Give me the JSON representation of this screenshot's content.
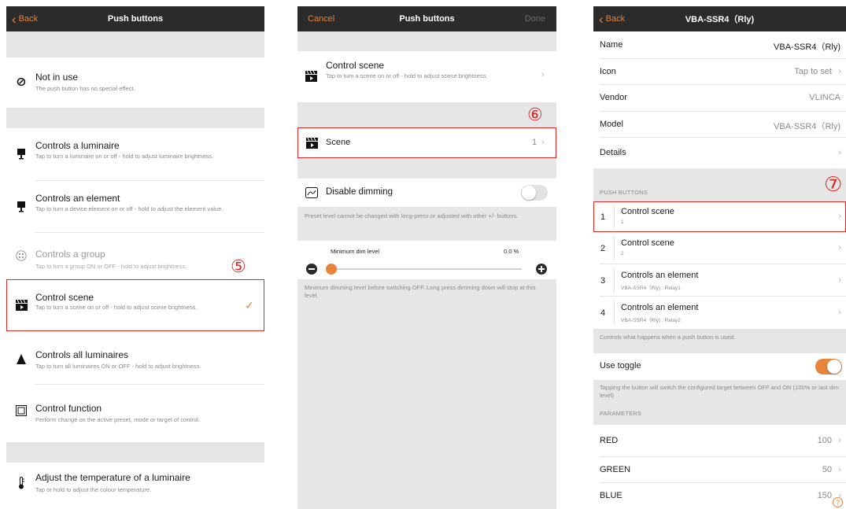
{
  "screen1": {
    "back_label": "Back",
    "title": "Push buttons",
    "items": [
      {
        "title": "Not in use",
        "subtitle": "The push button has no special effect."
      },
      {
        "title": "Controls a luminaire",
        "subtitle": "Tap to turn a luminaire on or off - hold to adjust luminaire brightness."
      },
      {
        "title": "Controls an element",
        "subtitle": "Tap to turn a device element on or off - hold to adjust the element value."
      },
      {
        "title": "Controls a group",
        "subtitle": "Tap to turn a group ON or OFF - hold to adjust brightness."
      },
      {
        "title": "Control scene",
        "subtitle": "Tap to turn a scene on or off - hold to adjust scene brightness."
      },
      {
        "title": "Controls all luminaires",
        "subtitle": "Tap to turn all luminaires ON or OFF - hold to adjust brightness."
      },
      {
        "title": "Control function",
        "subtitle": "Perform change on the active preset, mode or target of control."
      },
      {
        "title": "Adjust the temperature of a luminaire",
        "subtitle": "Tap or hold to adjust the colour temperature."
      }
    ],
    "annotation": "⑤",
    "check_mark": "✓"
  },
  "screen2": {
    "cancel_label": "Cancel",
    "title": "Push buttons",
    "done_label": "Done",
    "control_scene": {
      "title": "Control scene",
      "subtitle": "Tap to turn a scene on or off - hold to adjust scene brightness."
    },
    "annotation": "⑥",
    "scene": {
      "label": "Scene",
      "value": "1"
    },
    "disable_dimming": {
      "label": "Disable dimming",
      "toggle_on": false
    },
    "disable_note": "Preset level cannot be changed with long-press or adjusted with other +/- buttons.",
    "min_dim": {
      "label": "Minimum dim level",
      "value": "0.0 %",
      "slider_fraction": 0.0
    },
    "min_dim_note": "Minimum dimming level before switching OFF. Long press dimming down will stop at this level."
  },
  "screen3": {
    "back_label": "Back",
    "title": "VBA-SSR4（Rly)",
    "props": [
      {
        "label": "Name",
        "value": "VBA-SSR4（Rly)",
        "chevron": false
      },
      {
        "label": "Icon",
        "value": "Tap to set",
        "chevron": true
      },
      {
        "label": "Vendor",
        "value": "VLINCA",
        "chevron": false
      },
      {
        "label": "Model",
        "value": "VBA-SSR4（Rly)",
        "chevron": false
      },
      {
        "label": "Details",
        "value": "",
        "chevron": true
      }
    ],
    "push_buttons_header": "PUSH BUTTONS",
    "annotation": "⑦",
    "push_buttons": [
      {
        "num": "1",
        "title": "Control scene",
        "sub": "1"
      },
      {
        "num": "2",
        "title": "Control scene",
        "sub": "2"
      },
      {
        "num": "3",
        "title": "Controls an element",
        "sub": "VBA-SSR4（Rly) : Relay1"
      },
      {
        "num": "4",
        "title": "Controls an element",
        "sub": "VBA-SSR4（Rly) : Relay2"
      }
    ],
    "push_note": "Controls what happens when a push button is used.",
    "use_toggle": {
      "label": "Use toggle",
      "toggle_on": true
    },
    "toggle_note": "Tapping the button will switch the configured target between OFF and ON (100% or last dim level)",
    "parameters_header": "PARAMETERS",
    "parameters": [
      {
        "label": "RED",
        "value": "100"
      },
      {
        "label": "GREEN",
        "value": "50"
      },
      {
        "label": "BLUE",
        "value": "150"
      }
    ],
    "help_glyph": "?"
  },
  "colors": {
    "accent": "#e8833a",
    "navbar": "#2b2b2b",
    "annotation_red": "#d92a2a",
    "group_bg": "#e6e6e6"
  },
  "glyphs": {
    "chevron_right": "›",
    "back_chevron": "‹"
  }
}
